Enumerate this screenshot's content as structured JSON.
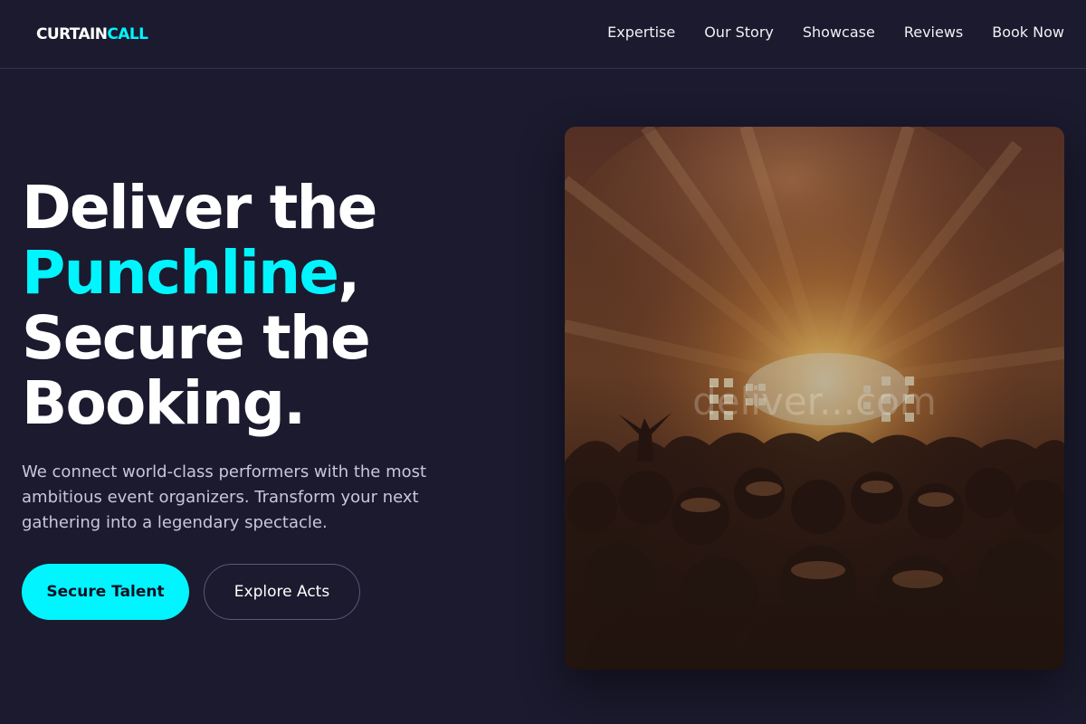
{
  "brand": {
    "name_part1": "CURTAIN",
    "name_part2": "CALL",
    "accent_color": "#00f5ff",
    "background_color": "#1b1a2e"
  },
  "nav": {
    "items": [
      "Expertise",
      "Our Story",
      "Showcase",
      "Reviews",
      "Book Now"
    ]
  },
  "hero": {
    "headline_line1": "Deliver the",
    "headline_highlight": "Punchline",
    "headline_comma": ",",
    "headline_line3": "Secure the",
    "headline_line4": "Booking.",
    "description": "We connect world-class performers with the most ambitious event organizers. Transform your next gathering into a legendary spectacle.",
    "primary_button": "Secure Talent",
    "secondary_button": "Explore Acts",
    "image_watermark": "deliver...com"
  }
}
